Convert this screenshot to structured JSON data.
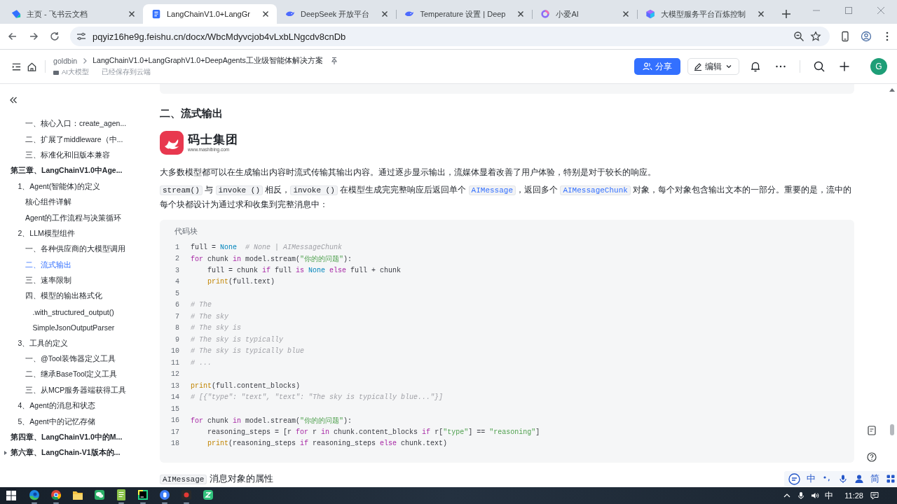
{
  "browser": {
    "tabs": [
      {
        "title": "主页 - 飞书云文档",
        "kind": "leaf",
        "selected": false
      },
      {
        "title": "LangChainV1.0+LangGr",
        "kind": "doc",
        "selected": true
      },
      {
        "title": "DeepSeek 开放平台",
        "kind": "whale",
        "selected": false
      },
      {
        "title": "Temperature 设置 | Deep",
        "kind": "whale",
        "selected": false
      },
      {
        "title": "小爱AI",
        "kind": "ring",
        "selected": false
      },
      {
        "title": "大模型服务平台百炼控制",
        "kind": "cube",
        "selected": false
      }
    ],
    "address": "pqyiz16he9g.feishu.cn/docx/WbcMdyvcjob4vLxbLNgcdv8cnDb"
  },
  "doc_header": {
    "breadcrumb": [
      "goldbin",
      "LangChainV1.0+LangGraphV1.0+DeepAgents工业级智能体解决方案"
    ],
    "folder": "AI大模型",
    "save_status": "已经保存到云端",
    "share_button": "分享",
    "edit_button": "编辑",
    "avatar": "G"
  },
  "sidebar": {
    "outline": [
      {
        "children": [
          {
            "children": [
              {
                "label": "一、核心入口：create_agen...",
                "selected": false
              },
              {
                "label": "二、扩展了middleware（中...",
                "selected": false
              },
              {
                "label": "三、标准化和旧版本兼容",
                "selected": false
              }
            ]
          }
        ]
      },
      {
        "label": "第三章、LangChainV1.0中Age...",
        "selected": false,
        "children": [
          {
            "label": "1、Agent(智能体)的定义",
            "selected": false,
            "children": [
              {
                "label": "核心组件详解",
                "selected": false
              },
              {
                "label": "Agent的工作流程与决策循环",
                "selected": false
              }
            ]
          },
          {
            "label": "2、LLM模型组件",
            "selected": false,
            "children": [
              {
                "label": "一、各种供应商的大模型调用",
                "selected": false
              },
              {
                "label": "二、流式输出",
                "selected": true
              },
              {
                "label": "三、速率限制",
                "selected": false
              },
              {
                "label": "四、模型的输出格式化",
                "selected": false,
                "children": [
                  {
                    "label": ".with_structured_output()",
                    "selected": false
                  },
                  {
                    "label": "SimpleJsonOutputParser",
                    "selected": false
                  }
                ]
              }
            ]
          },
          {
            "label": "3、工具的定义",
            "selected": false,
            "children": [
              {
                "label": "一、@Tool装饰器定义工具",
                "selected": false
              },
              {
                "label": "二、继承BaseTool定义工具",
                "selected": false
              },
              {
                "label": "三、从MCP服务器端获得工具",
                "selected": false
              }
            ]
          },
          {
            "label": "4、Agent的消息和状态",
            "selected": false
          },
          {
            "label": "5、Agent中的记忆存储",
            "selected": false
          }
        ]
      },
      {
        "label": "第四章、LangChainV1.0中的M...",
        "selected": false
      },
      {
        "label": "第六章、LangChain-V1版本的...",
        "selected": false,
        "expanded": false
      }
    ]
  },
  "document": {
    "heading": "二、流式输出",
    "logo": {
      "name": "码士集团",
      "url": "www.mashibing.com"
    },
    "paragraphs": [
      {
        "segments": [
          {
            "kind": "text",
            "text": "大多数模型都可以在生成输出内容时流式传输其输出内容。通过逐步显示输出，流媒体显着改善了用户体验，特别是对于较长的响应。"
          }
        ]
      },
      {
        "segments": [
          {
            "kind": "code",
            "text": "stream()"
          },
          {
            "kind": "text",
            "text": " 与 "
          },
          {
            "kind": "code",
            "text": "invoke ()"
          },
          {
            "kind": "text",
            "text": " 相反，"
          },
          {
            "kind": "code",
            "text": "invoke ()"
          },
          {
            "kind": "text",
            "text": " 在模型生成完完整响应后返回单个 "
          },
          {
            "kind": "code_link",
            "text": "AIMessage"
          },
          {
            "kind": "text",
            "text": "，返回多个 "
          },
          {
            "kind": "code_link",
            "text": "AIMessageChunk"
          },
          {
            "kind": "text",
            "text": " 对象，每个对象包含输出文本的一部分。重要的是，流中的每个块都设计为通过求和收集到完整消息中："
          }
        ]
      }
    ],
    "code_block": {
      "label": "代码块",
      "lines": [
        {
          "number": "1",
          "tokens": [
            {
              "kind": "plain",
              "text": "full = "
            },
            {
              "kind": "constant",
              "text": "None"
            },
            {
              "kind": "comment",
              "text": "  # None | AIMessageChunk"
            }
          ]
        },
        {
          "number": "2",
          "tokens": [
            {
              "kind": "keyword",
              "text": "for"
            },
            {
              "kind": "plain",
              "text": " chunk "
            },
            {
              "kind": "keyword",
              "text": "in"
            },
            {
              "kind": "plain",
              "text": " model.stream("
            },
            {
              "kind": "string",
              "text": "\"你的的问题\""
            },
            {
              "kind": "plain",
              "text": "):"
            }
          ]
        },
        {
          "number": "3",
          "tokens": [
            {
              "kind": "plain",
              "text": "    full = chunk "
            },
            {
              "kind": "keyword",
              "text": "if"
            },
            {
              "kind": "plain",
              "text": " full "
            },
            {
              "kind": "keyword",
              "text": "is "
            },
            {
              "kind": "constant",
              "text": "None "
            },
            {
              "kind": "keyword",
              "text": "else"
            },
            {
              "kind": "plain",
              "text": " full + chunk"
            }
          ]
        },
        {
          "number": "4",
          "tokens": [
            {
              "kind": "function",
              "text": "    print"
            },
            {
              "kind": "plain",
              "text": "(full.text)"
            }
          ]
        },
        {
          "number": "5"
        },
        {
          "number": "6",
          "tokens": [
            {
              "kind": "comment",
              "text": "# The"
            }
          ]
        },
        {
          "number": "7",
          "tokens": [
            {
              "kind": "comment",
              "text": "# The sky"
            }
          ]
        },
        {
          "number": "8",
          "tokens": [
            {
              "kind": "comment",
              "text": "# The sky is"
            }
          ]
        },
        {
          "number": "9",
          "tokens": [
            {
              "kind": "comment",
              "text": "# The sky is typically"
            }
          ]
        },
        {
          "number": "10",
          "tokens": [
            {
              "kind": "comment",
              "text": "# The sky is typically blue"
            }
          ]
        },
        {
          "number": "11",
          "tokens": [
            {
              "kind": "comment",
              "text": "# ..."
            }
          ]
        },
        {
          "number": "12"
        },
        {
          "number": "13",
          "tokens": [
            {
              "kind": "function",
              "text": "print"
            },
            {
              "kind": "plain",
              "text": "(full.content_blocks)"
            }
          ]
        },
        {
          "number": "14",
          "tokens": [
            {
              "kind": "comment",
              "text": "# [{\"type\": \"text\", \"text\": \"The sky is typically blue...\"}]"
            }
          ]
        },
        {
          "number": "15"
        },
        {
          "number": "16",
          "tokens": [
            {
              "kind": "keyword",
              "text": "for"
            },
            {
              "kind": "plain",
              "text": " chunk "
            },
            {
              "kind": "keyword",
              "text": "in"
            },
            {
              "kind": "plain",
              "text": " model.stream("
            },
            {
              "kind": "string",
              "text": "\"你的的问题\""
            },
            {
              "kind": "plain",
              "text": "):"
            }
          ]
        },
        {
          "number": "17",
          "tokens": [
            {
              "kind": "plain",
              "text": "    reasoning_steps = [r "
            },
            {
              "kind": "keyword",
              "text": "for"
            },
            {
              "kind": "plain",
              "text": " r "
            },
            {
              "kind": "keyword",
              "text": "in"
            },
            {
              "kind": "plain",
              "text": " chunk.content_blocks "
            },
            {
              "kind": "keyword",
              "text": "if"
            },
            {
              "kind": "plain",
              "text": " r["
            },
            {
              "kind": "string",
              "text": "\"type\""
            },
            {
              "kind": "plain",
              "text": "] == "
            },
            {
              "kind": "string",
              "text": "\"reasoning\""
            },
            {
              "kind": "plain",
              "text": "]"
            }
          ]
        },
        {
          "number": "18",
          "tokens": [
            {
              "kind": "function",
              "text": "    print"
            },
            {
              "kind": "plain",
              "text": "(reasoning_steps "
            },
            {
              "kind": "keyword",
              "text": "if"
            },
            {
              "kind": "plain",
              "text": " reasoning_steps "
            },
            {
              "kind": "keyword",
              "text": "else"
            },
            {
              "kind": "plain",
              "text": " chunk.text)"
            }
          ]
        }
      ]
    },
    "subheading": {
      "segments": [
        {
          "kind": "code",
          "text": "AIMessage"
        },
        {
          "kind": "text",
          "text": " 消息对象的属性"
        }
      ]
    }
  },
  "ime_toolbar": {
    "mode": "中",
    "script": "简"
  },
  "taskbar": {
    "apps": [
      {
        "kind": "edge",
        "running": true
      },
      {
        "kind": "chrome",
        "running": true
      },
      {
        "kind": "folder",
        "running": false
      },
      {
        "kind": "chat",
        "running": false
      },
      {
        "kind": "notepad",
        "running": true
      },
      {
        "kind": "editor",
        "running": true
      },
      {
        "kind": "circle",
        "running": true
      },
      {
        "kind": "record",
        "running": true
      },
      {
        "kind": "zigzag",
        "running": false
      }
    ],
    "input_mode": "中",
    "clock": "11:28"
  }
}
